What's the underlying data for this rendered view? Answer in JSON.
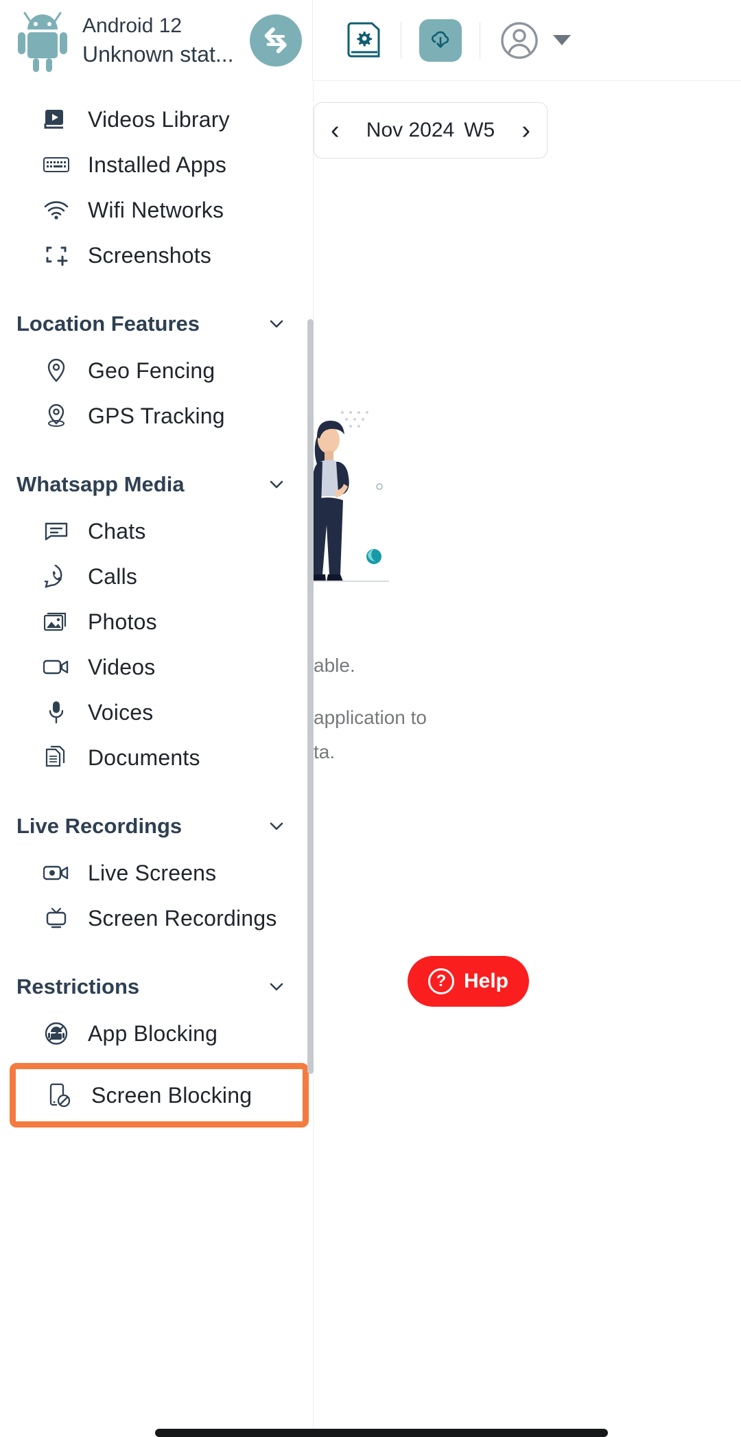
{
  "header": {
    "device_os": "Android 12",
    "device_status": "Unknown stat...",
    "logo_icon": "android-robot-icon",
    "sync_icon": "sync-swap-icon",
    "guide_icon": "guide-book-gear-icon",
    "download_icon": "cloud-download-icon",
    "account_icon": "account-circle-icon",
    "account_caret_icon": "chevron-down-icon"
  },
  "content": {
    "date_nav": {
      "prev_icon": "chevron-left-icon",
      "next_icon": "chevron-right-icon",
      "month_year": "Nov 2024",
      "week": "W5"
    },
    "empty_state": {
      "illustration": "standing-woman-illustration",
      "line1": "able.",
      "line2": "application to",
      "line3": "ta."
    },
    "help_button": {
      "label": "Help",
      "icon": "question-circle-icon",
      "color": "#fa1e1e"
    }
  },
  "sidebar": {
    "top_items": [
      {
        "label": "Videos Library",
        "icon": "video-library-icon"
      },
      {
        "label": "Installed Apps",
        "icon": "keyboard-icon"
      },
      {
        "label": "Wifi Networks",
        "icon": "wifi-icon"
      },
      {
        "label": "Screenshots",
        "icon": "screenshot-frame-icon"
      }
    ],
    "sections": [
      {
        "title": "Location Features",
        "chevron": "chevron-down-icon",
        "items": [
          {
            "label": "Geo Fencing",
            "icon": "map-pin-icon"
          },
          {
            "label": "GPS Tracking",
            "icon": "gps-pin-icon"
          }
        ]
      },
      {
        "title": "Whatsapp Media",
        "chevron": "chevron-down-icon",
        "items": [
          {
            "label": "Chats",
            "icon": "chat-box-icon"
          },
          {
            "label": "Calls",
            "icon": "whatsapp-phone-icon"
          },
          {
            "label": "Photos",
            "icon": "photos-icon"
          },
          {
            "label": "Videos",
            "icon": "video-camera-icon"
          },
          {
            "label": "Voices",
            "icon": "microphone-icon"
          },
          {
            "label": "Documents",
            "icon": "documents-icon"
          }
        ]
      },
      {
        "title": "Live Recordings",
        "chevron": "chevron-down-icon",
        "items": [
          {
            "label": "Live Screens",
            "icon": "live-camera-icon"
          },
          {
            "label": "Screen Recordings",
            "icon": "tv-monitor-icon"
          }
        ]
      },
      {
        "title": "Restrictions",
        "chevron": "chevron-down-icon",
        "items": [
          {
            "label": "App Blocking",
            "icon": "app-blocked-icon"
          }
        ],
        "highlighted_item": {
          "label": "Screen Blocking",
          "icon": "screen-blocked-icon"
        }
      }
    ],
    "highlight_color": "#f47b3f"
  }
}
